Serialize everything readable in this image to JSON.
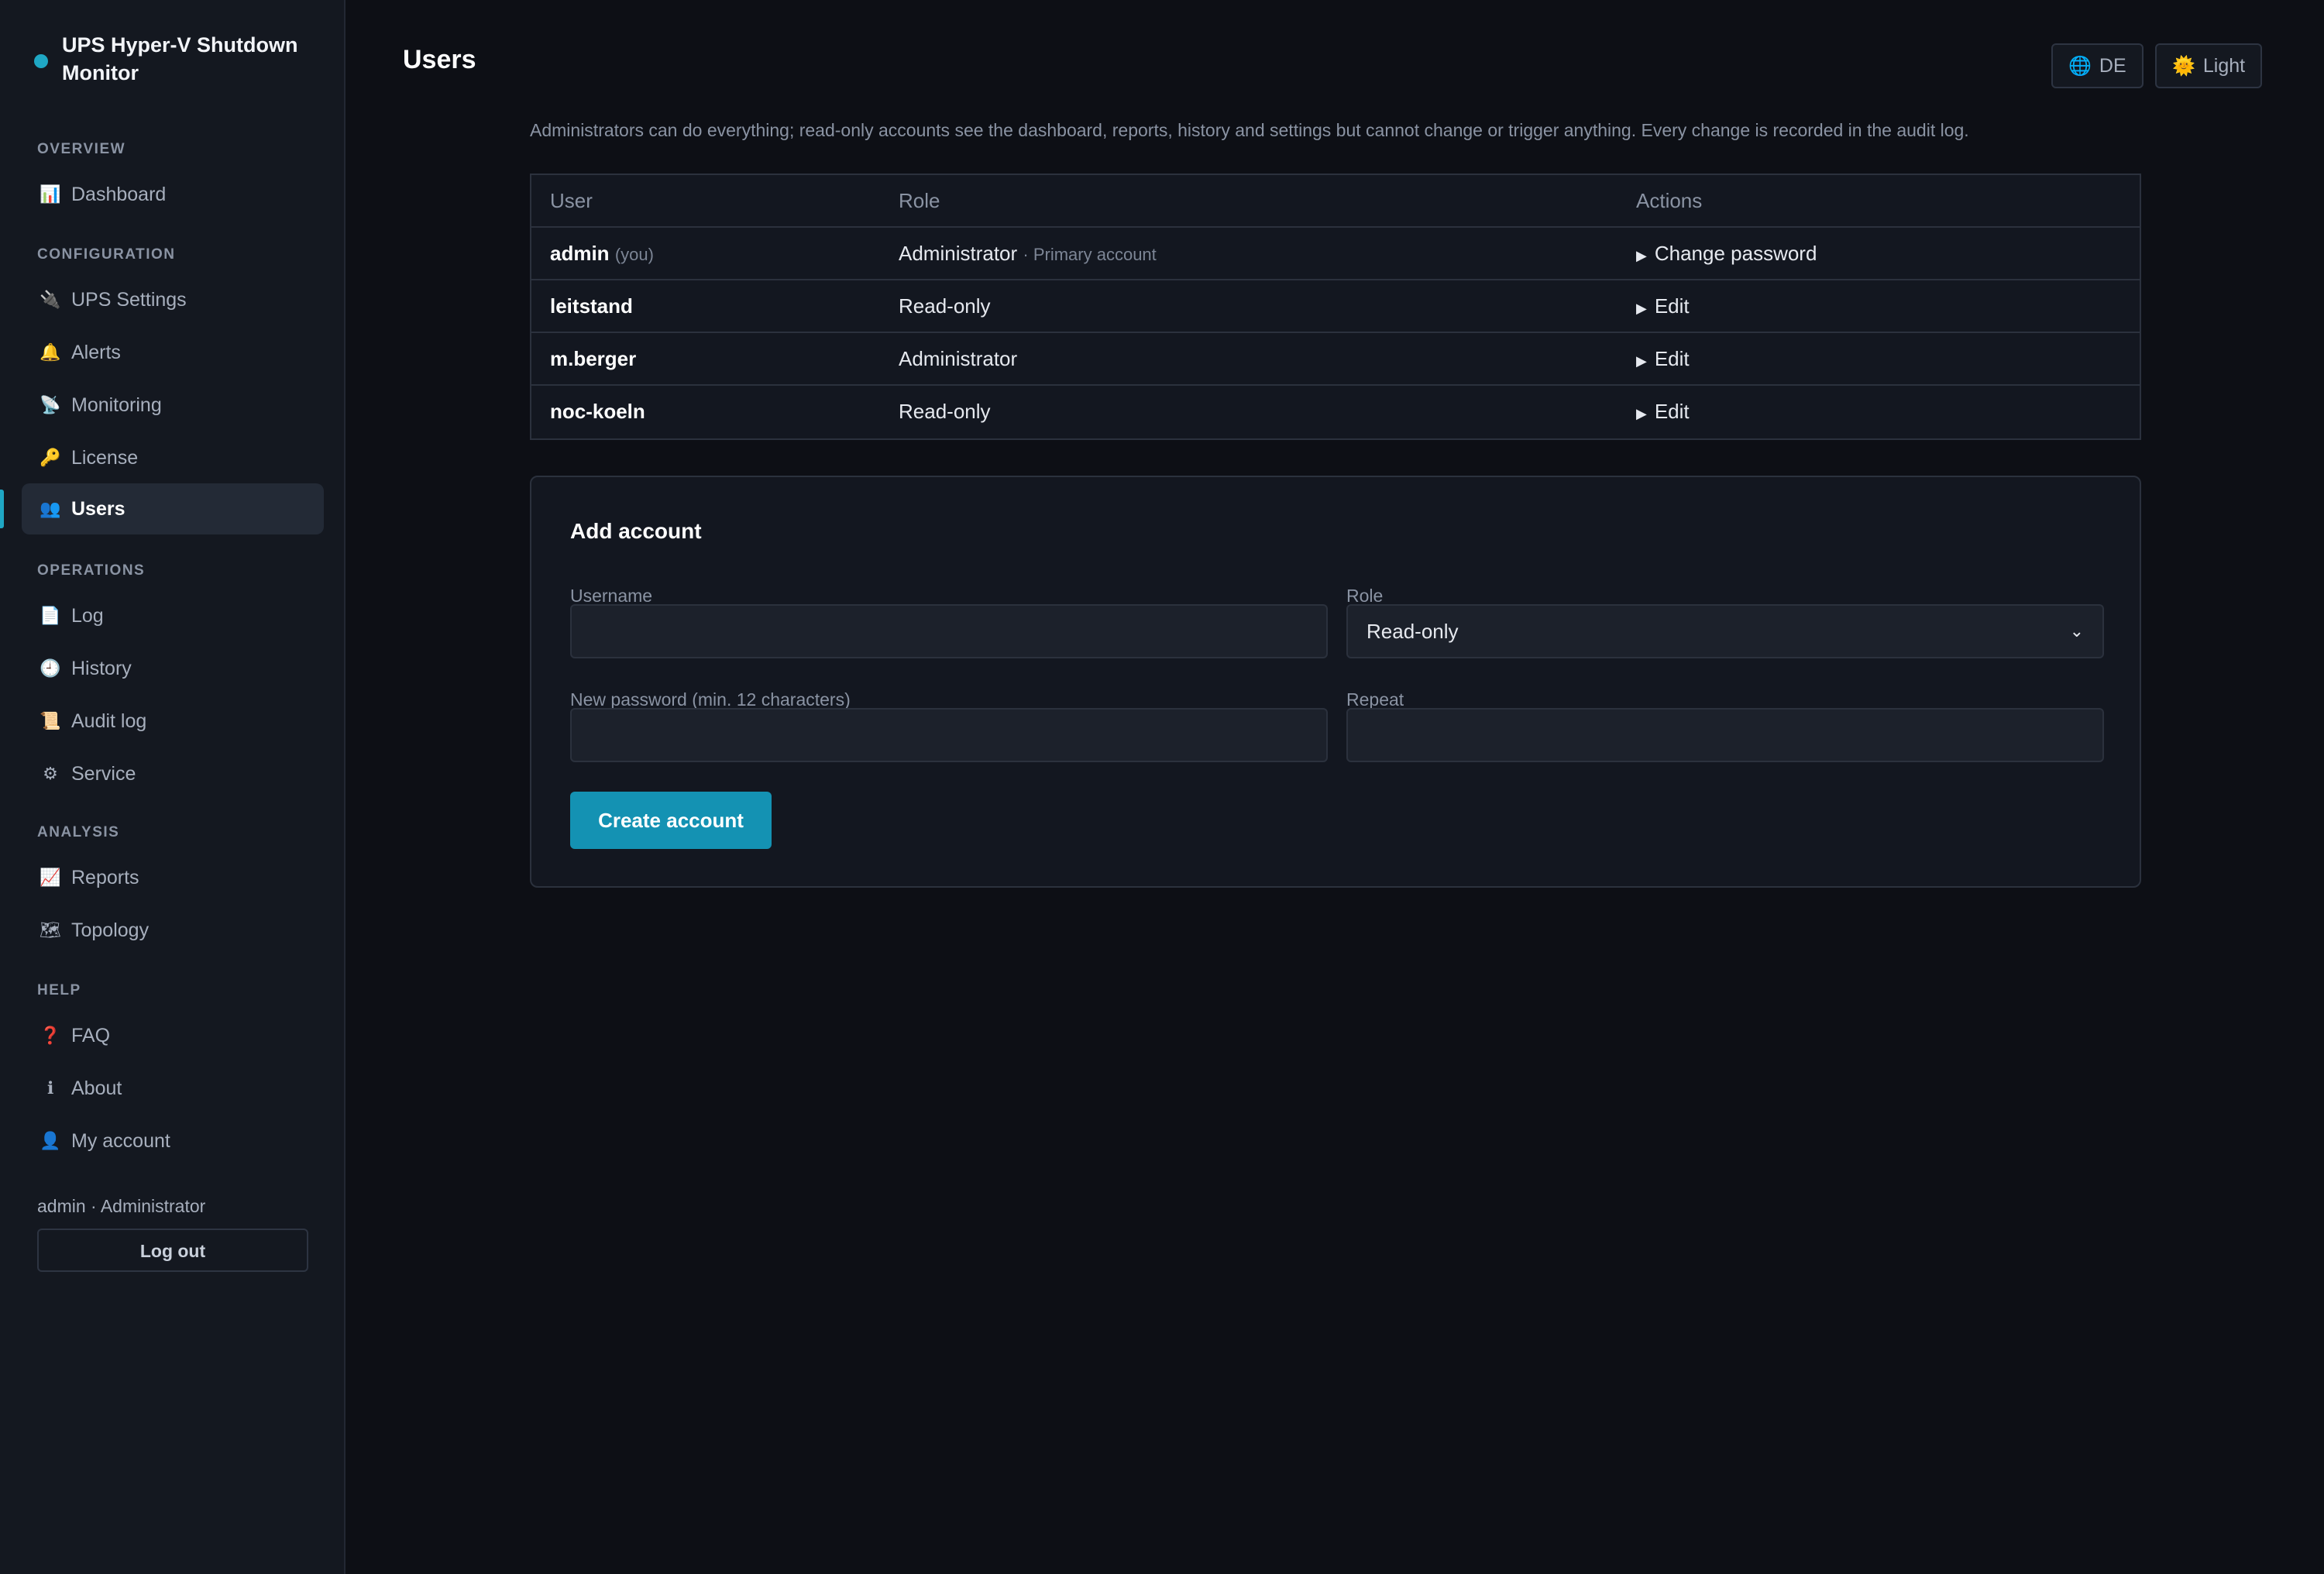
{
  "app": {
    "title": "UPS Hyper-V Shutdown Monitor"
  },
  "sidebar": {
    "sections": [
      {
        "label": "OVERVIEW",
        "items": [
          {
            "label": "Dashboard",
            "icon": "bar-chart-icon",
            "glyph": "📊"
          }
        ]
      },
      {
        "label": "CONFIGURATION",
        "items": [
          {
            "label": "UPS Settings",
            "icon": "plug-icon",
            "glyph": "🔌"
          },
          {
            "label": "Alerts",
            "icon": "bell-icon",
            "glyph": "🔔"
          },
          {
            "label": "Monitoring",
            "icon": "satellite-icon",
            "glyph": "📡"
          },
          {
            "label": "License",
            "icon": "key-icon",
            "glyph": "🔑"
          },
          {
            "label": "Users",
            "icon": "users-icon",
            "glyph": "👥",
            "active": true
          }
        ]
      },
      {
        "label": "OPERATIONS",
        "items": [
          {
            "label": "Log",
            "icon": "document-icon",
            "glyph": "📄"
          },
          {
            "label": "History",
            "icon": "clock-icon",
            "glyph": "🕘"
          },
          {
            "label": "Audit log",
            "icon": "scroll-icon",
            "glyph": "📜"
          },
          {
            "label": "Service",
            "icon": "gear-icon",
            "glyph": "⚙"
          }
        ]
      },
      {
        "label": "ANALYSIS",
        "items": [
          {
            "label": "Reports",
            "icon": "line-chart-icon",
            "glyph": "📈"
          },
          {
            "label": "Topology",
            "icon": "map-icon",
            "glyph": "🗺"
          }
        ]
      },
      {
        "label": "HELP",
        "items": [
          {
            "label": "FAQ",
            "icon": "question-icon",
            "glyph": "❓"
          },
          {
            "label": "About",
            "icon": "info-icon",
            "glyph": "ℹ"
          },
          {
            "label": "My account",
            "icon": "person-icon",
            "glyph": "👤"
          }
        ]
      }
    ],
    "current_user": "admin · Administrator",
    "logout_label": "Log out"
  },
  "header": {
    "title": "Users",
    "language_label": "DE",
    "theme_label": "Light"
  },
  "intro_text": "Administrators can do everything; read-only accounts see the dashboard, reports, history and settings but cannot change or trigger anything. Every change is recorded in the audit log.",
  "users_table": {
    "columns": [
      "User",
      "Role",
      "Actions"
    ],
    "rows": [
      {
        "user": "admin",
        "suffix": "(you)",
        "role": "Administrator",
        "role_note": "· Primary account",
        "action": "Change password"
      },
      {
        "user": "leitstand",
        "suffix": "",
        "role": "Read-only",
        "role_note": "",
        "action": "Edit"
      },
      {
        "user": "m.berger",
        "suffix": "",
        "role": "Administrator",
        "role_note": "",
        "action": "Edit"
      },
      {
        "user": "noc-koeln",
        "suffix": "",
        "role": "Read-only",
        "role_note": "",
        "action": "Edit"
      }
    ]
  },
  "add_account": {
    "title": "Add account",
    "username_label": "Username",
    "username_value": "",
    "role_label": "Role",
    "role_value": "Read-only",
    "password_label": "New password (min. 12 characters)",
    "password_value": "",
    "repeat_label": "Repeat",
    "repeat_value": "",
    "submit_label": "Create account"
  },
  "colors": {
    "accent": "#1fa7c4",
    "button": "#1492b3",
    "background": "#0d0f15",
    "sidebar": "#141820"
  }
}
